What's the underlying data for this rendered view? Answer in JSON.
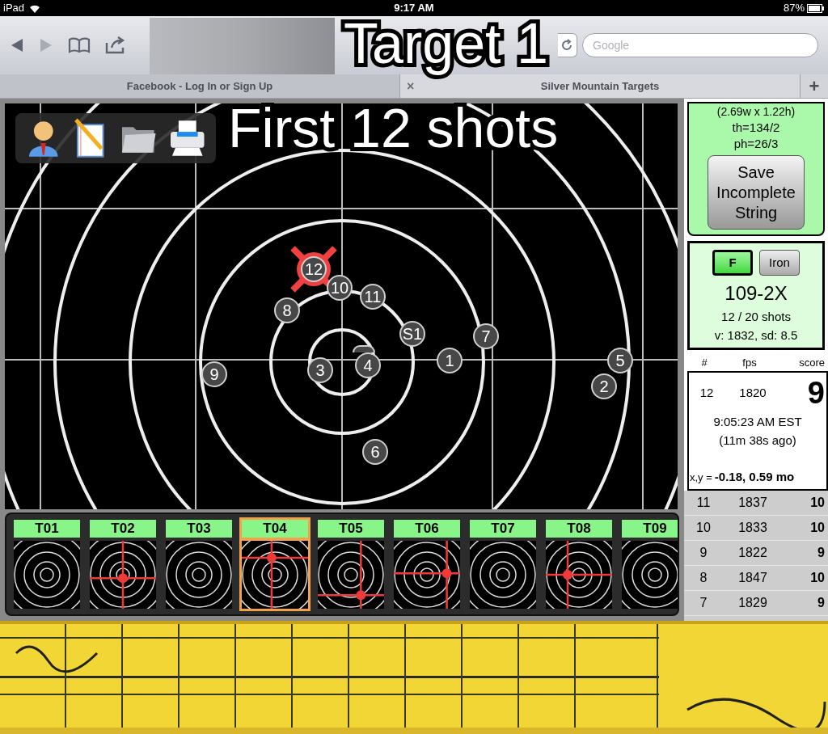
{
  "status_bar": {
    "device": "iPad",
    "time": "9:17 AM",
    "battery": "87%"
  },
  "browser": {
    "search_placeholder": "Google",
    "close_tab": "×",
    "new_tab": "+",
    "tabs": [
      {
        "label": "Facebook - Log In or Sign Up",
        "selected": false
      },
      {
        "label": "Silver Mountain Targets",
        "selected": true
      }
    ]
  },
  "overlay": {
    "title": "Target 1",
    "subtitle": "First 12 shots"
  },
  "target": {
    "shots": [
      {
        "label": "12",
        "selected": true
      },
      {
        "label": "10",
        "selected": false
      },
      {
        "label": "11",
        "selected": false
      },
      {
        "label": "8",
        "selected": false
      },
      {
        "label": "S1",
        "selected": false
      },
      {
        "label": "7",
        "selected": false
      },
      {
        "label": "1",
        "selected": false
      },
      {
        "label": "9",
        "selected": false
      },
      {
        "label": "3",
        "selected": false
      },
      {
        "label": "4",
        "selected": false
      },
      {
        "label": "6",
        "selected": false
      },
      {
        "label": "5",
        "selected": false
      },
      {
        "label": "2",
        "selected": false
      }
    ]
  },
  "thumbnails": [
    {
      "label": "T01",
      "selected": false,
      "marked": false
    },
    {
      "label": "T02",
      "selected": false,
      "marked": true
    },
    {
      "label": "T03",
      "selected": false,
      "marked": false
    },
    {
      "label": "T04",
      "selected": true,
      "marked": true
    },
    {
      "label": "T05",
      "selected": false,
      "marked": true
    },
    {
      "label": "T06",
      "selected": false,
      "marked": true
    },
    {
      "label": "T07",
      "selected": false,
      "marked": false
    },
    {
      "label": "T08",
      "selected": false,
      "marked": true
    },
    {
      "label": "T09",
      "selected": false,
      "marked": false
    }
  ],
  "info_card": {
    "size": "(2.69w x 1.22h)",
    "th": "th=134/2",
    "ph": "ph=26/3",
    "save_button": "Save Incomplete String"
  },
  "sight": {
    "buttons": [
      {
        "label": "F",
        "selected": true
      },
      {
        "label": "Iron",
        "selected": false
      }
    ],
    "score": "109-2X",
    "shots": "12 / 20 shots",
    "stats": "v: 1832, sd: 8.5"
  },
  "shot_table": {
    "columns": [
      "#",
      "fps",
      "score"
    ],
    "current": {
      "number": "12",
      "fps": "1820",
      "score": "9",
      "time": "9:05:23 AM EST",
      "ago": "(11m 38s ago)",
      "xy_label": "x,y =",
      "xy": "-0.18, 0.59 mo"
    },
    "rows": [
      {
        "number": "11",
        "fps": "1837",
        "score": "10"
      },
      {
        "number": "10",
        "fps": "1833",
        "score": "10"
      },
      {
        "number": "9",
        "fps": "1822",
        "score": "9"
      },
      {
        "number": "8",
        "fps": "1847",
        "score": "10"
      },
      {
        "number": "7",
        "fps": "1829",
        "score": "9"
      }
    ]
  }
}
